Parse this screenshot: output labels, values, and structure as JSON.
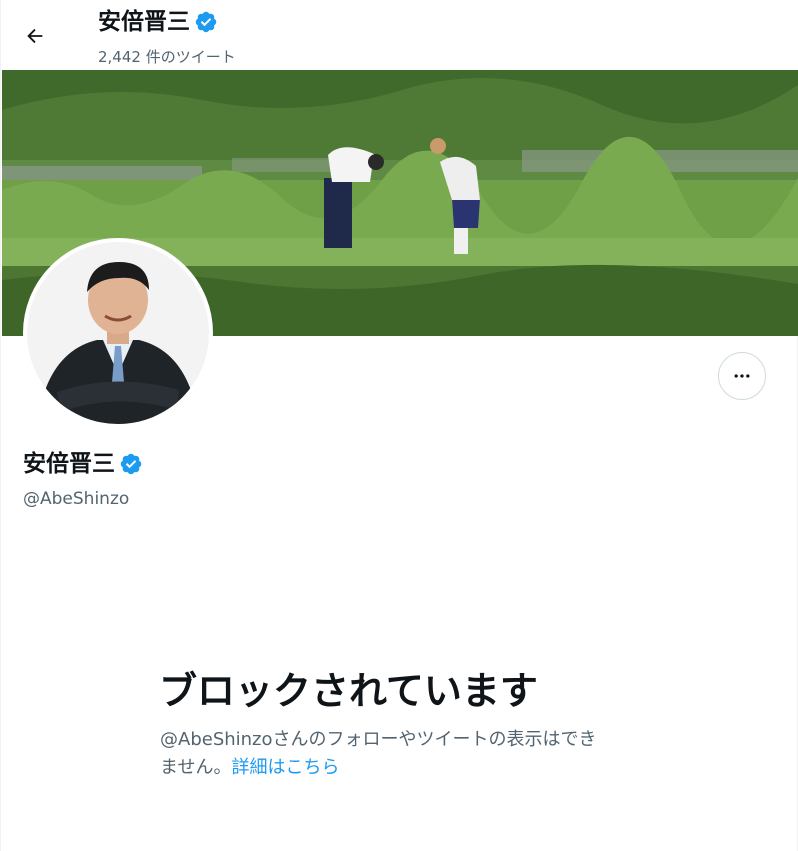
{
  "header": {
    "title": "安倍晋三",
    "tweet_count": "2,442 件のツイート"
  },
  "profile": {
    "name": "安倍晋三",
    "handle": "@AbeShinzo"
  },
  "blocked": {
    "title": "ブロックされています",
    "description_line1": "@AbeShinzoさんのフォローやツイートの表示はでき",
    "description_line2": "ません。",
    "learn_more": "詳細はこちら"
  },
  "icons": {
    "back": "arrow-left-icon",
    "verified": "verified-badge-icon",
    "more": "more-horizontal-icon"
  },
  "colors": {
    "accent": "#1d9bf0",
    "text_primary": "#0f1419",
    "text_secondary": "#536471",
    "border": "#cfd9de"
  }
}
